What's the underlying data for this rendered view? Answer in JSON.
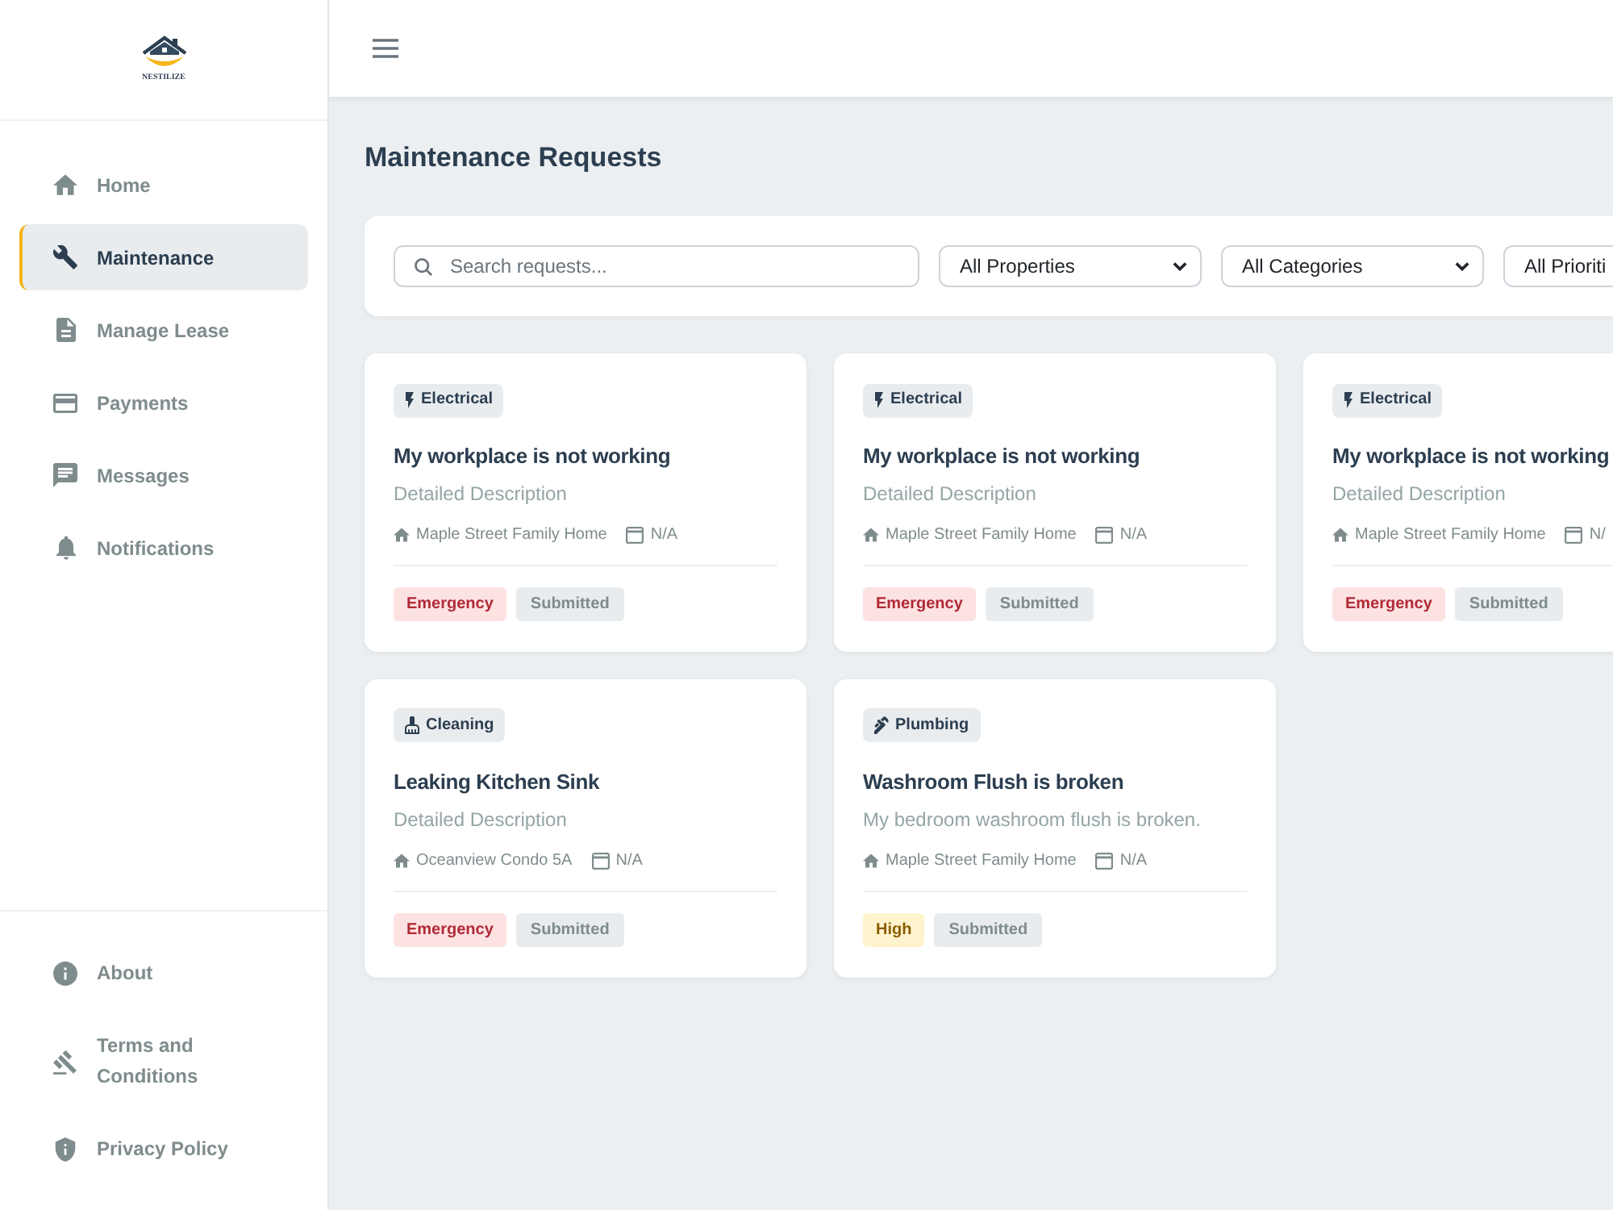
{
  "sidebar": {
    "logo_text": "NESTILIZE",
    "nav_items": [
      {
        "label": "Home",
        "selected": false
      },
      {
        "label": "Maintenance",
        "selected": true
      },
      {
        "label": "Manage Lease",
        "selected": false
      },
      {
        "label": "Payments",
        "selected": false
      },
      {
        "label": "Messages",
        "selected": false
      },
      {
        "label": "Notifications",
        "selected": false
      }
    ],
    "footer_items": [
      {
        "label": "About"
      },
      {
        "label": "Terms and Conditions"
      },
      {
        "label": "Privacy Policy"
      }
    ]
  },
  "page": {
    "title": "Maintenance Requests"
  },
  "filters": {
    "search": {
      "placeholder": "Search requests..."
    },
    "dropdowns": [
      "All Properties",
      "All Categories",
      "All Prioriti"
    ]
  },
  "requests": [
    {
      "category": {
        "label": "Electrical",
        "kind": "electrical"
      },
      "title": "My workplace is not working",
      "description": "Detailed Description",
      "property": "Maple Street Family Home",
      "date": "N/A",
      "priority": {
        "label": "Emergency",
        "kind": "emergency"
      },
      "status": "Submitted"
    },
    {
      "category": {
        "label": "Electrical",
        "kind": "electrical"
      },
      "title": "My workplace is not working",
      "description": "Detailed Description",
      "property": "Maple Street Family Home",
      "date": "N/A",
      "priority": {
        "label": "Emergency",
        "kind": "emergency"
      },
      "status": "Submitted"
    },
    {
      "category": {
        "label": "Electrical",
        "kind": "electrical"
      },
      "title": "My workplace is not working",
      "description": "Detailed Description",
      "property": "Maple Street Family Home",
      "date": "N/",
      "priority": {
        "label": "Emergency",
        "kind": "emergency"
      },
      "status": "Submitted"
    },
    {
      "category": {
        "label": "Cleaning",
        "kind": "cleaning"
      },
      "title": "Leaking Kitchen Sink",
      "description": "Detailed Description",
      "property": "Oceanview Condo 5A",
      "date": "N/A",
      "priority": {
        "label": "Emergency",
        "kind": "emergency"
      },
      "status": "Submitted"
    },
    {
      "category": {
        "label": "Plumbing",
        "kind": "plumbing"
      },
      "title": "Washroom Flush is broken",
      "description": "My bedroom washroom flush is broken.",
      "property": "Maple Street Family Home",
      "date": "N/A",
      "priority": {
        "label": "High",
        "kind": "high"
      },
      "status": "Submitted"
    }
  ]
}
